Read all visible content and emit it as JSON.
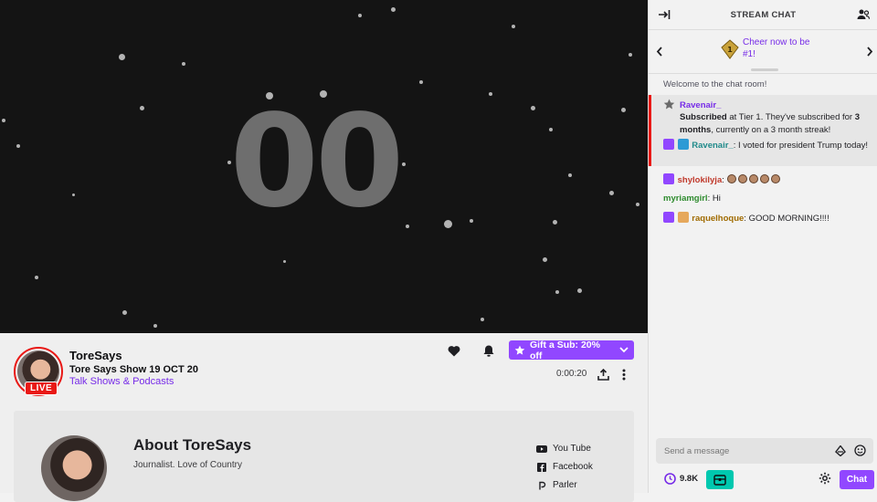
{
  "video": {
    "countdown": "00"
  },
  "channel": {
    "name": "ToreSays",
    "stream_title": "Tore Says Show 19 OCT 20",
    "category": "Talk Shows & Podcasts",
    "live_label": "LIVE",
    "uptime": "0:00:20",
    "gift_button": "Gift a Sub: 20% off"
  },
  "about": {
    "title": "About ToreSays",
    "description": "Journalist. Love of Country",
    "links": [
      {
        "label": "You Tube",
        "icon": "youtube-icon"
      },
      {
        "label": "Facebook",
        "icon": "facebook-icon"
      },
      {
        "label": "Parler",
        "icon": "parler-icon"
      }
    ]
  },
  "chat": {
    "header": "STREAM CHAT",
    "cheer_text": "Cheer now to be #1!",
    "cheer_rank": "1",
    "welcome": "Welcome to the chat room!",
    "sub_notice": {
      "user": "Ravenair_",
      "line_prefix": "Subscribed",
      "line_mid": " at Tier 1. They've subscribed for ",
      "months": "3 months",
      "line_suffix": ", currently on a 3 month streak!"
    },
    "messages": [
      {
        "user": "Ravenair_",
        "color": "#1f8a8a",
        "text": ": I voted for president Trump today!"
      },
      {
        "user": "shylokilyja",
        "color": "#c0392b",
        "text": ":"
      },
      {
        "user": "myriamgirl",
        "color": "#2e8b2e",
        "text": ": Hi"
      },
      {
        "user": "raquelhoque",
        "color": "#a06b00",
        "text": ": GOOD MORNING!!!!"
      }
    ],
    "input_placeholder": "Send a message",
    "points": "9.8K",
    "chat_button": "Chat"
  },
  "colors": {
    "accent": "#9147ff",
    "live": "#e91916",
    "points_claim": "#00c8af"
  }
}
